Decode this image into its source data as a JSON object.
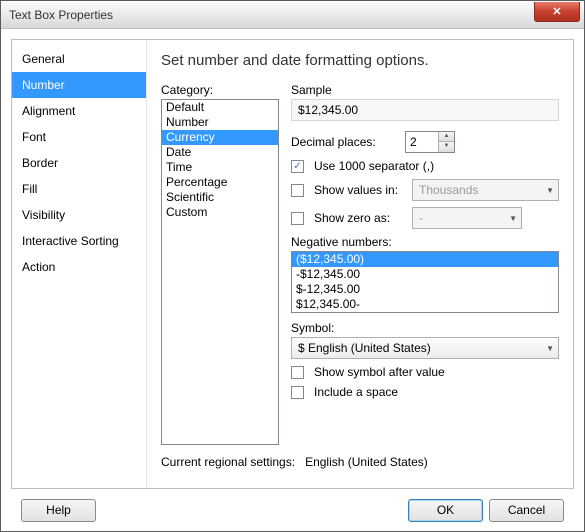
{
  "window": {
    "title": "Text Box Properties"
  },
  "sidebar": {
    "items": [
      {
        "label": "General"
      },
      {
        "label": "Number"
      },
      {
        "label": "Alignment"
      },
      {
        "label": "Font"
      },
      {
        "label": "Border"
      },
      {
        "label": "Fill"
      },
      {
        "label": "Visibility"
      },
      {
        "label": "Interactive Sorting"
      },
      {
        "label": "Action"
      }
    ],
    "selected": 1
  },
  "panel": {
    "heading": "Set number and date formatting options.",
    "category_label": "Category:",
    "categories": [
      "Default",
      "Number",
      "Currency",
      "Date",
      "Time",
      "Percentage",
      "Scientific",
      "Custom"
    ],
    "category_selected": 2,
    "sample_label": "Sample",
    "sample_value": "$12,345.00",
    "decimal_label": "Decimal places:",
    "decimal_value": "2",
    "use_sep_label": "Use 1000 separator (,)",
    "use_sep_checked": true,
    "show_values_label": "Show values in:",
    "show_values_value": "Thousands",
    "show_values_checked": false,
    "show_zero_label": "Show zero as:",
    "show_zero_value": "-",
    "show_zero_checked": false,
    "negative_label": "Negative numbers:",
    "negative_items": [
      "($12,345.00)",
      "-$12,345.00",
      "$-12,345.00",
      "$12,345.00-"
    ],
    "negative_selected": 0,
    "symbol_label": "Symbol:",
    "symbol_value": "$ English (United States)",
    "show_after_label": "Show symbol after value",
    "show_after_checked": false,
    "include_space_label": "Include a space",
    "include_space_checked": false,
    "regional_label": "Current regional settings:",
    "regional_value": "English (United States)"
  },
  "buttons": {
    "help": "Help",
    "ok": "OK",
    "cancel": "Cancel"
  }
}
